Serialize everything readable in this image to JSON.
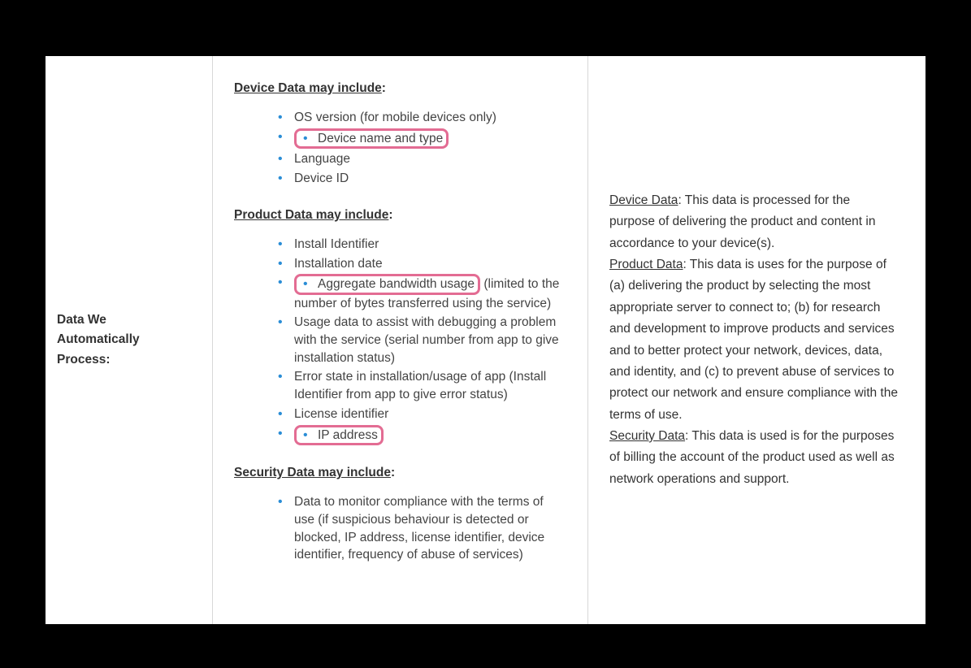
{
  "row_label_line1": "Data We",
  "row_label_line2": "Automatically",
  "row_label_line3": "Process:",
  "device_data": {
    "heading": "Device Data may include",
    "items": [
      {
        "text": "OS version (for mobile devices only)",
        "highlight": false
      },
      {
        "text": "Device name and type",
        "highlight": true,
        "highlight_includes_bullet": true
      },
      {
        "text": "Language",
        "highlight": false
      },
      {
        "text": "Device ID",
        "highlight": false
      }
    ]
  },
  "product_data": {
    "heading": "Product Data may include",
    "items": [
      {
        "text": "Install Identifier",
        "highlight": false
      },
      {
        "text": "Installation date",
        "highlight": false
      },
      {
        "text": "Aggregate bandwidth usage",
        "trailing": " (limited to the number of bytes transferred using the service)",
        "highlight": true,
        "highlight_includes_bullet": true
      },
      {
        "text": "Usage data to assist with debugging a problem with the service (serial number from app to give installation status)",
        "highlight": false
      },
      {
        "text": "Error state in installation/usage of app (Install Identifier from app to give error status)",
        "highlight": false
      },
      {
        "text": "License identifier",
        "highlight": false
      },
      {
        "text": "IP address",
        "highlight": true,
        "highlight_includes_bullet": true
      }
    ]
  },
  "security_data": {
    "heading": "Security Data may include",
    "items": [
      {
        "text": "Data to monitor compliance with the terms of use (if suspicious behaviour is detected or blocked, IP address, license identifier, device identifier, frequency of abuse of services)",
        "highlight": false
      }
    ]
  },
  "right": {
    "device_label": "Device Data",
    "device_text": ": This data is processed for the purpose of delivering the product and content in accordance to your device(s).",
    "product_label": "Product Data",
    "product_text": ": This data is uses for the purpose of (a) delivering the product by selecting the most appropriate server to connect to; (b) for research and development to improve products and services and to better protect your network, devices, data, and identity, and (c) to prevent abuse of services to protect our network and ensure compliance with the terms of use.",
    "security_label": "Security Data",
    "security_text": ": This data is used is for the purposes of billing the account of the product used as well as network operations and support."
  },
  "colors": {
    "highlight_border": "#e36c93",
    "bullet": "#2a8dd6"
  }
}
